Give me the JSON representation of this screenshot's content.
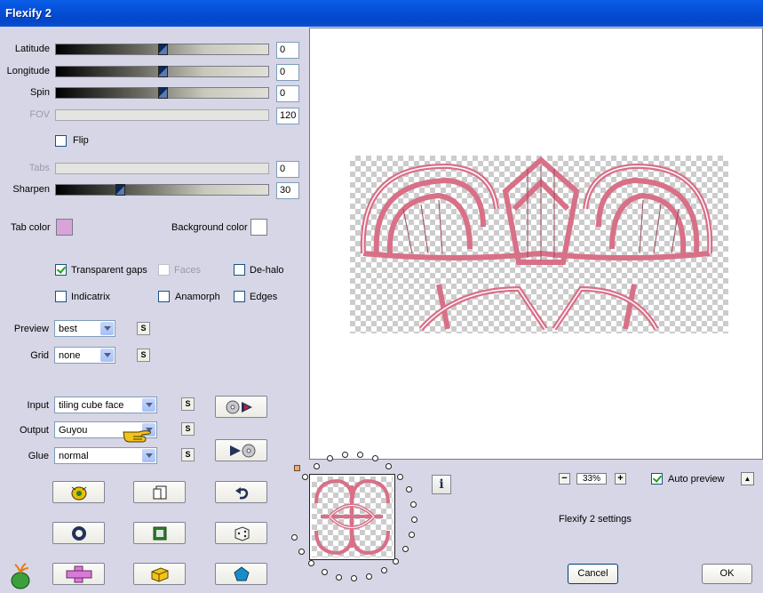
{
  "window": {
    "title": "Flexify 2"
  },
  "sliders": {
    "latitude": {
      "label": "Latitude",
      "value": "0",
      "level": 0.5
    },
    "longitude": {
      "label": "Longitude",
      "value": "0",
      "level": 0.5
    },
    "spin": {
      "label": "Spin",
      "value": "0",
      "level": 0.5
    },
    "fov": {
      "label": "FOV",
      "value": "120"
    },
    "tabs": {
      "label": "Tabs",
      "value": "0"
    },
    "sharpen": {
      "label": "Sharpen",
      "value": "30",
      "level": 0.3
    }
  },
  "flip": {
    "label": "Flip",
    "checked": false
  },
  "colors": {
    "tab_color_label": "Tab color",
    "tab_color": "#d8a4d8",
    "background_color_label": "Background color",
    "background_color": "#ffffff"
  },
  "options": {
    "transparent_gaps": {
      "label": "Transparent gaps",
      "checked": true
    },
    "faces": {
      "label": "Faces",
      "checked": false,
      "disabled": true
    },
    "dehalo": {
      "label": "De-halo",
      "checked": false
    },
    "indicatrix": {
      "label": "Indicatrix",
      "checked": false
    },
    "anamorph": {
      "label": "Anamorph",
      "checked": false
    },
    "edges": {
      "label": "Edges",
      "checked": false
    }
  },
  "preview_select": {
    "label": "Preview",
    "value": "best"
  },
  "grid_select": {
    "label": "Grid",
    "value": "none"
  },
  "input_select": {
    "label": "Input",
    "value": "tiling cube face"
  },
  "output_select": {
    "label": "Output",
    "value": "Guyou"
  },
  "glue_select": {
    "label": "Glue",
    "value": "normal"
  },
  "s_label": "S",
  "zoom": {
    "value": "33%",
    "minus": "−",
    "plus": "+"
  },
  "auto_preview": {
    "label": "Auto preview",
    "checked": true
  },
  "settings_label": "Flexify 2 settings",
  "info_label": "i",
  "up_label": "▲",
  "buttons": {
    "cancel": "Cancel",
    "ok": "OK"
  },
  "accent_colors": {
    "pink": "#d87088",
    "navy": "#22325a",
    "green": "#2e7a2e",
    "gold": "#e8c000"
  }
}
